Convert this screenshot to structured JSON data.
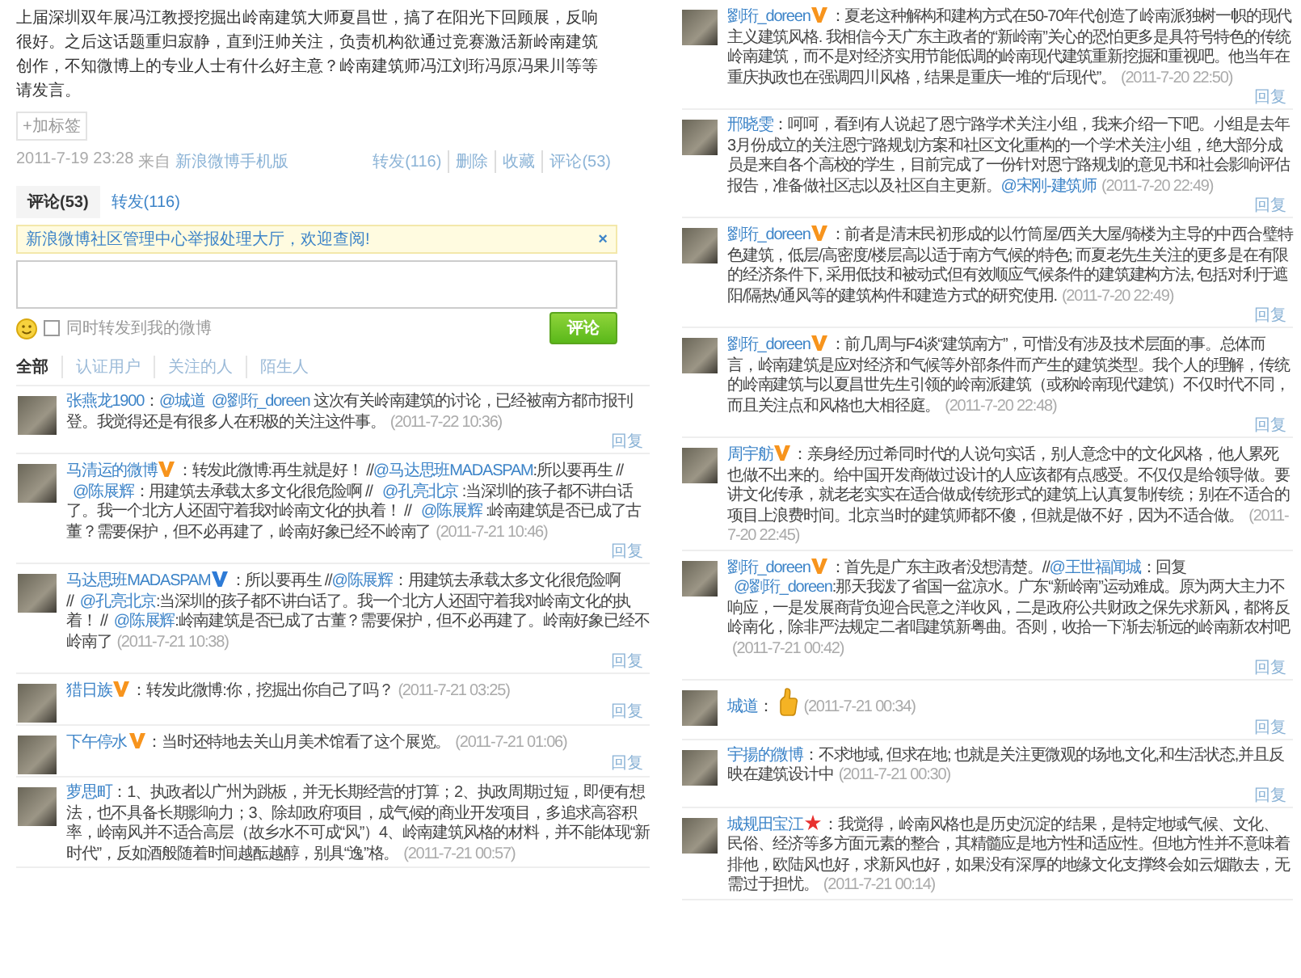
{
  "post": {
    "text": "上届深圳双年展冯江教授挖掘出岭南建筑大师夏昌世，搞了在阳光下回顾展，反响很好。之后这话题重归寂静，直到汪帅关注，负责机构欲通过竞赛激活新岭南建筑创作，不知微博上的专业人士有什么好主意？岭南建筑师冯江刘珩冯原冯果川等等请发言。",
    "tag_button": "+加标签",
    "time": "2011-7-19 23:28",
    "via": "来自",
    "client": "新浪微博手机版",
    "actions": [
      "转发(116)",
      "删除",
      "收藏",
      "评论(53)"
    ]
  },
  "tabs": [
    {
      "label": "评论(53)",
      "selected": true
    },
    {
      "label": "转发(116)",
      "selected": false
    }
  ],
  "notice": {
    "text": "新浪微博社区管理中心举报处理大厅，欢迎查阅!",
    "close": "×"
  },
  "compose": {
    "repost": {
      "label": "同时转发到我的微博",
      "checked": false
    },
    "submit": "评论"
  },
  "filters": [
    {
      "label": "全部",
      "selected": true
    },
    {
      "label": "认证用户",
      "selected": false
    },
    {
      "label": "关注的人",
      "selected": false
    },
    {
      "label": "陌生人",
      "selected": false
    }
  ],
  "left_comments": [
    {
      "author": "张燕龙1900",
      "kind": "plain",
      "content": [
        {
          "kind": "text",
          "text": "："
        },
        {
          "kind": "mention",
          "text": "@城道"
        },
        {
          "kind": "mention",
          "text": "@劉珩_doreen"
        },
        {
          "kind": "text",
          "text": " 这次有关岭南建筑的讨论，已经被南方都市报刊登。我觉得还是有很多人在积极的关注这件事。"
        }
      ],
      "time": "(2011-7-22 10:36)",
      "reply": "回复"
    },
    {
      "author": "马清运的微博",
      "kind": "personal",
      "content": [
        {
          "kind": "text",
          "text": "：转发此微博:再生就是好！ //"
        },
        {
          "kind": "mention",
          "text": "@马达思班MADASPAM"
        },
        {
          "kind": "text",
          "text": ":所以要再生 // "
        },
        {
          "kind": "mention",
          "text": "@陈展辉"
        },
        {
          "kind": "text",
          "text": "：用建筑去承载太多文化很危险啊 // "
        },
        {
          "kind": "mention",
          "text": "@孔亮北京"
        },
        {
          "kind": "text",
          "text": " :当深圳的孩子都不讲白话了。我一个北方人还固守着我对岭南文化的执着！ // "
        },
        {
          "kind": "mention",
          "text": "@陈展辉"
        },
        {
          "kind": "text",
          "text": " :岭南建筑是否已成了古董？需要保护，但不必再建了，岭南好象已经不岭南了"
        }
      ],
      "time": "(2011-7-21 10:46)",
      "reply": "回复"
    },
    {
      "author": "马达思班MADASPAM",
      "kind": "organization",
      "content": [
        {
          "kind": "text",
          "text": "：所以要再生 //"
        },
        {
          "kind": "mention",
          "text": "@陈展辉"
        },
        {
          "kind": "text",
          "text": "：用建筑去承载太多文化很危险啊 //"
        },
        {
          "kind": "mention",
          "text": "@孔亮北京"
        },
        {
          "kind": "text",
          "text": ":当深圳的孩子都不讲白话了。我一个北方人还固守着我对岭南文化的执着！ //"
        },
        {
          "kind": "mention",
          "text": "@陈展辉"
        },
        {
          "kind": "text",
          "text": ":岭南建筑是否已成了古董？需要保护，但不必再建了。岭南好象已经不岭南了"
        }
      ],
      "time": "(2011-7-21 10:38)",
      "reply": "回复"
    },
    {
      "author": "猎日族",
      "kind": "personal",
      "content": [
        {
          "kind": "text",
          "text": "：转发此微博:你，挖掘出你自己了吗？"
        }
      ],
      "time": "(2011-7-21 03:25)",
      "reply": "回复"
    },
    {
      "author": "下午停水",
      "kind": "personal",
      "content": [
        {
          "kind": "text",
          "text": "：当时还特地去关山月美术馆看了这个展览。"
        }
      ],
      "time": "(2011-7-21 01:06)",
      "reply": "回复"
    },
    {
      "author": "萝思町",
      "kind": "plain",
      "content": [
        {
          "kind": "text",
          "text": "：1、执政者以广州为跳板，并无长期经营的打算；2、执政周期过短，即便有想法，也不具备长期影响力；3、除却政府项目，成气候的商业开发项目，多追求高容积率，岭南风并不适合高层（故乡水不可成“风”）4、岭南建筑风格的材料，并不能体现“新时代”，反如酒般随着时间越酝越醇，别具“逸”格。"
        }
      ],
      "time": "(2011-7-21 00:57)"
    }
  ],
  "right_comments": [
    {
      "author": "劉珩_doreen",
      "kind": "personal",
      "content": [
        {
          "kind": "text",
          "text": "：夏老这种解构和建构方式在50-70年代创造了岭南派独树一帜的现代主义建筑风格. 我相信今天广东主政者的“新岭南”关心的恐怕更多是具符号特色的传统岭南建筑，而不是对经济实用节能低调的岭南现代建筑重新挖掘和重视吧。他当年在重庆执政也在强调四川风格，结果是重庆一堆的“后现代”。"
        }
      ],
      "time": "(2011-7-20 22:50)",
      "reply": "回复"
    },
    {
      "author": "邢晓雯",
      "kind": "plain",
      "content": [
        {
          "kind": "text",
          "text": "：呵呵，看到有人说起了恩宁路学术关注小组，我来介绍一下吧。小组是去年3月份成立的关注恩宁路规划方案和社区文化重构的一个学术关注小组，绝大部分成员是来自各个高校的学生，目前完成了一份针对恩宁路规划的意见书和社会影响评估报告，准备做社区志以及社区自主更新。"
        },
        {
          "kind": "mention",
          "text": "@宋刚-建筑师"
        }
      ],
      "time": "(2011-7-20 22:49)",
      "reply": "回复"
    },
    {
      "author": "劉珩_doreen",
      "kind": "personal",
      "content": [
        {
          "kind": "text",
          "text": "：前者是清末民初形成的以竹筒屋/西关大屋/骑楼为主导的中西合璧特色建筑，低层/高密度/楼层高以适于南方气候的特色; 而夏老先生关注的更多是在有限的经济条件下, 采用低技和被动式但有效顺应气候条件的建筑建构方法, 包括对利于遮阳/隔热/通风等的建筑构件和建造方式的研究使用."
        }
      ],
      "time": "(2011-7-20 22:49)",
      "reply": "回复"
    },
    {
      "author": "劉珩_doreen",
      "kind": "personal",
      "content": [
        {
          "kind": "text",
          "text": "：前几周与F4谈“建筑南方”，可惜没有涉及技术层面的事。总体而言，岭南建筑是应对经济和气候等外部条件而产生的建筑类型。我个人的理解，传统的岭南建筑与以夏昌世先生引领的岭南派建筑（或称岭南现代建筑）不仅时代不同，而且关注点和风格也大相径庭。"
        }
      ],
      "time": "(2011-7-20 22:48)",
      "reply": "回复"
    },
    {
      "author": "周宇舫",
      "kind": "personal",
      "content": [
        {
          "kind": "text",
          "text": "：亲身经历过希同时代的人说句实话，别人意念中的文化风格，他人累死也做不出来的。给中国开发商做过设计的人应该都有点感受。不仅仅是给领导做。要讲文化传承，就老老实实在适合做成传统形式的建筑上认真复制传统；别在不适合的项目上浪费时间。北京当时的建筑师都不傻，但就是做不好，因为不适合做。"
        }
      ],
      "time": "(2011-7-20 22:45)"
    },
    {
      "author": "劉珩_doreen",
      "kind": "personal",
      "content": [
        {
          "kind": "text",
          "text": "：首先是广东主政者没想清楚。//"
        },
        {
          "kind": "mention",
          "text": "@王世福闻城"
        },
        {
          "kind": "text",
          "text": "：回复"
        },
        {
          "kind": "mention",
          "text": "@劉珩_doreen"
        },
        {
          "kind": "text",
          "text": ":那天我泼了省国一盆凉水。广东“新岭南”运动难成。原为两大主力不响应，一是发展商背负迎合民意之洋收风，二是政府公共财政之保先求新风，都将反岭南化，除非严法规定二者唱建筑新粤曲。否则，收拾一下渐去渐远的岭南新农村吧"
        }
      ],
      "time": "(2011-7-21 00:42)",
      "reply": "回复"
    },
    {
      "author": "城道",
      "kind": "plain",
      "content": [
        {
          "kind": "text",
          "text": "："
        },
        {
          "kind": "emoji"
        }
      ],
      "time": "(2011-7-21 00:34)",
      "reply": "回复"
    },
    {
      "author": "宇揚的微博",
      "kind": "plain",
      "content": [
        {
          "kind": "text",
          "text": "：不求地域, 但求在地; 也就是关注更微观的场地,文化,和生活状态,并且反映在建筑设计中"
        }
      ],
      "time": "(2011-7-21 00:30)",
      "reply": "回复"
    },
    {
      "author": "城规田宝江",
      "kind": "talent",
      "content": [
        {
          "kind": "text",
          "text": "：我觉得，岭南风格也是历史沉淀的结果，是特定地域气候、文化、民俗、经济等多方面元素的整合，其精髓应是地方性和适应性。但地方性并不意味着排他，欧陆风也好，求新风也好，如果没有深厚的地缘文化支撑终会如云烟散去，无需过于担忧。"
        }
      ],
      "time": "(2011-7-21 00:14)"
    }
  ]
}
